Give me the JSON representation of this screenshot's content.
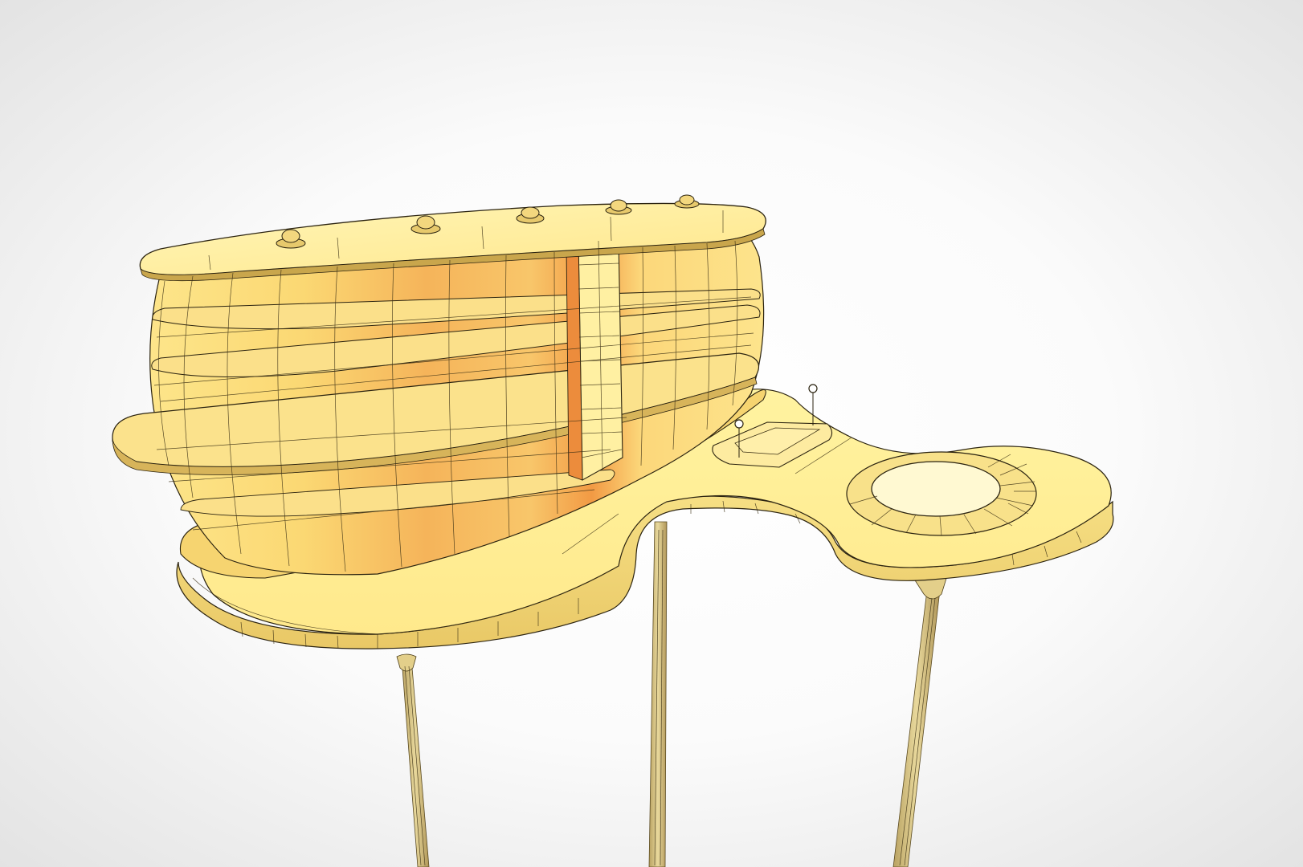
{
  "viewport": {
    "render_style": "wireframe-on-shaded",
    "colors": {
      "background_center": "#ffffff",
      "background_edge": "#e3e3e3",
      "surface_light": "#fff3a6",
      "surface_mid": "#fbd36a",
      "surface_warm": "#f2a046",
      "surface_shadow": "#e08a3a",
      "leg": "#d8c486",
      "wire": "#2b2310"
    }
  },
  "model": {
    "object": "desk-with-curved-shelving",
    "shelf_knob_count": 5,
    "leg_count": 3,
    "has_round_cutout": true,
    "has_rectangular_inset": true,
    "has_cable_posts": 2
  }
}
